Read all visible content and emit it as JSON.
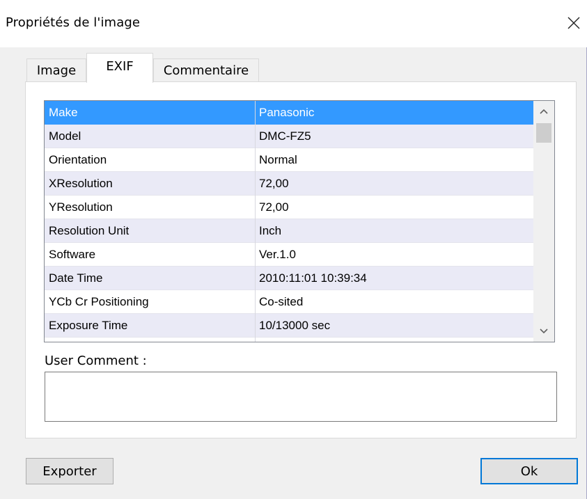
{
  "window": {
    "title": "Propriétés de l'image"
  },
  "tabs": [
    {
      "label": "Image"
    },
    {
      "label": "EXIF"
    },
    {
      "label": "Commentaire"
    }
  ],
  "active_tab": "EXIF",
  "exif": {
    "rows": [
      {
        "name": "Make",
        "value": "Panasonic",
        "selected": true
      },
      {
        "name": "Model",
        "value": "DMC-FZ5"
      },
      {
        "name": "Orientation",
        "value": "Normal"
      },
      {
        "name": "XResolution",
        "value": "72,00"
      },
      {
        "name": "YResolution",
        "value": "72,00"
      },
      {
        "name": "Resolution Unit",
        "value": "Inch"
      },
      {
        "name": "Software",
        "value": "Ver.1.0"
      },
      {
        "name": "Date Time",
        "value": "2010:11:01 10:39:34"
      },
      {
        "name": "YCb Cr Positioning",
        "value": "Co-sited"
      },
      {
        "name": "Exposure Time",
        "value": "10/13000 sec"
      }
    ]
  },
  "comment": {
    "label": "User Comment :",
    "value": ""
  },
  "buttons": {
    "export_label": "Exporter",
    "ok_label": "Ok"
  },
  "colors": {
    "selection": "#3399ff",
    "alt_row": "#eaeaf6",
    "ok_focus_border": "#0078d7"
  }
}
